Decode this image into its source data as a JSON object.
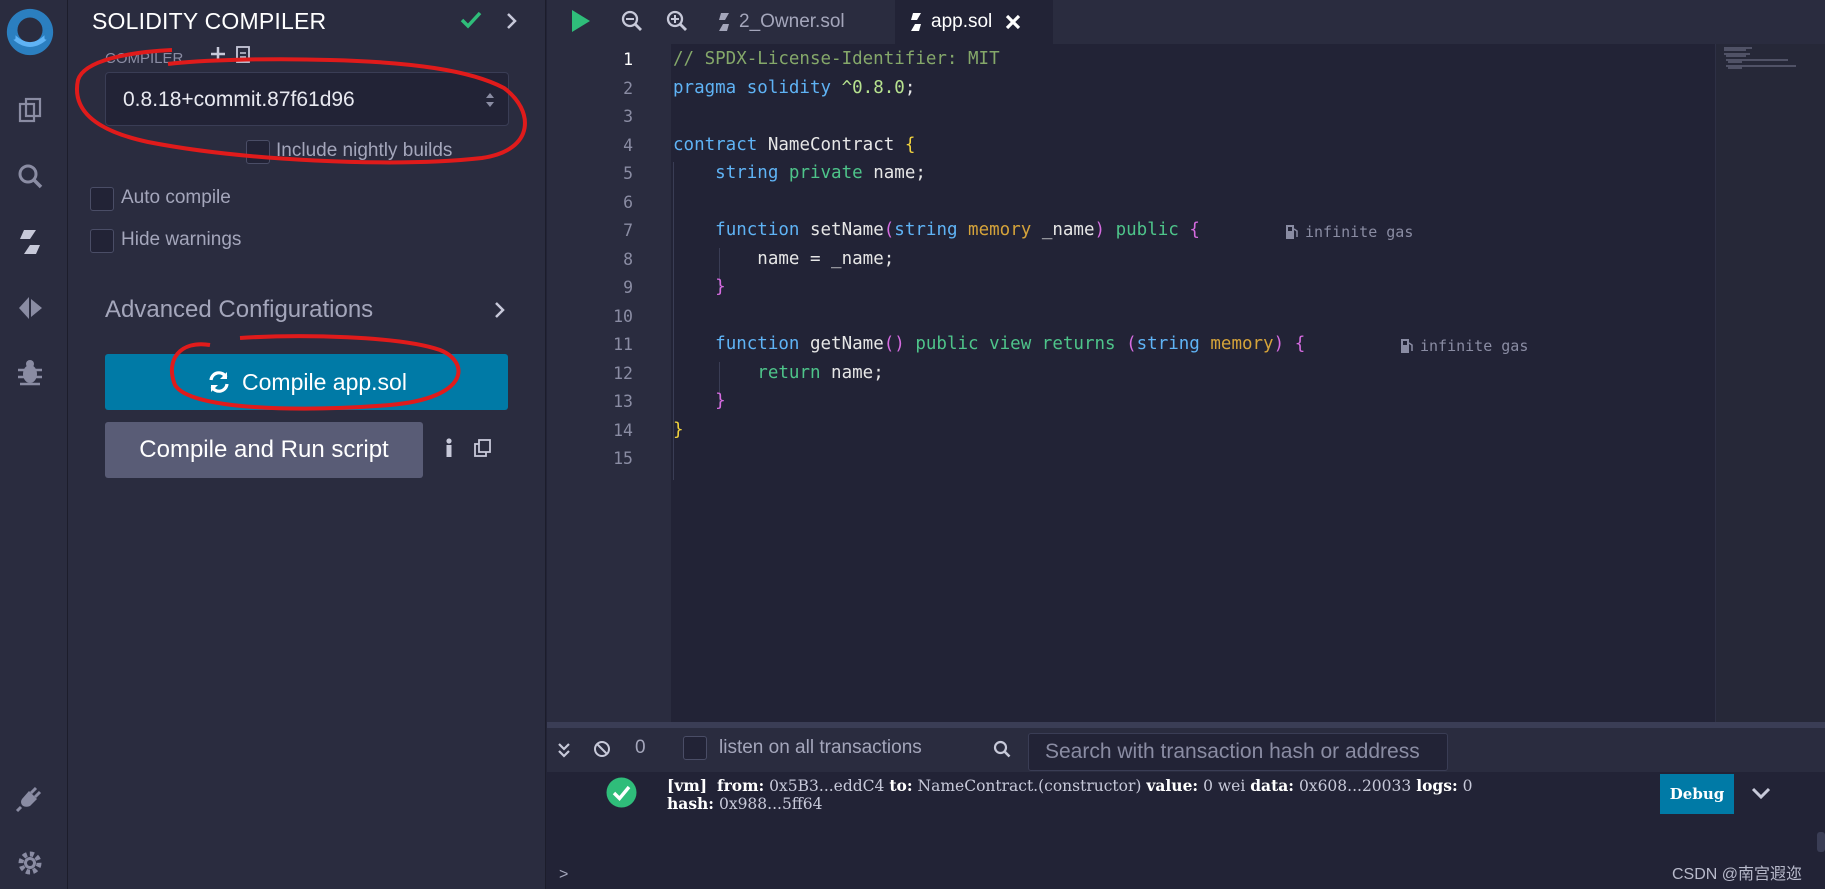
{
  "panel": {
    "title": "SOLIDITY COMPILER",
    "compiler_label": "COMPILER",
    "version": "0.8.18+commit.87f61d96",
    "include_nightly": "Include nightly builds",
    "auto_compile": "Auto compile",
    "hide_warnings": "Hide warnings",
    "advanced": "Advanced Configurations",
    "compile_button": "Compile app.sol",
    "run_button": "Compile and Run script"
  },
  "tabs": {
    "owner": "2_Owner.sol",
    "app": "app.sol"
  },
  "editor": {
    "line_numbers": [
      "1",
      "2",
      "3",
      "4",
      "5",
      "6",
      "7",
      "8",
      "9",
      "10",
      "11",
      "12",
      "13",
      "14",
      "15"
    ],
    "gas_label": "infinite gas",
    "code": {
      "l1": "// SPDX-License-Identifier: MIT",
      "l2_kw": "pragma solidity",
      "l2_ver": "^0.8.0",
      "l2_end": ";",
      "l4_kw": "contract",
      "l4_name": " NameContract ",
      "l4_br": "{",
      "l5_type": "string",
      "l5_mod": " private",
      "l5_rest": " name;",
      "l7_kw": "function",
      "l7_name": " setName",
      "l7_p1": "(",
      "l7_type": "string",
      "l7_loc": " memory",
      "l7_arg": " _name",
      "l7_p2": ")",
      "l7_vis": " public",
      "l7_br": " {",
      "l8": "name = _name;",
      "l9": "}",
      "l11_kw": "function",
      "l11_name": " getName",
      "l11_p1": "()",
      "l11_vis": " public view returns",
      "l11_p2": " (",
      "l11_type": "string",
      "l11_loc": " memory",
      "l11_p3": ")",
      "l11_br": " {",
      "l12_kw": "return",
      "l12_rest": " name;",
      "l13": "}",
      "l14": "}"
    }
  },
  "terminal": {
    "count": "0",
    "listen": "listen on all transactions",
    "search_placeholder": "Search with transaction hash or address",
    "log": {
      "vm": "[vm]",
      "from_label": "from:",
      "from": "0x5B3...eddC4",
      "to_label": "to:",
      "to": "NameContract.(constructor)",
      "value_label": "value:",
      "value": "0 wei",
      "data_label": "data:",
      "data": "0x608...20033",
      "logs_label": "logs:",
      "logs": "0",
      "hash_label": "hash:",
      "hash": "0x988...5ff64"
    },
    "debug": "Debug",
    "prompt": ">"
  },
  "watermark": "CSDN @南宫遐迩",
  "colors": {
    "accent": "#007aa6",
    "success": "#2fbd7a",
    "annotation": "#e01b1b"
  }
}
